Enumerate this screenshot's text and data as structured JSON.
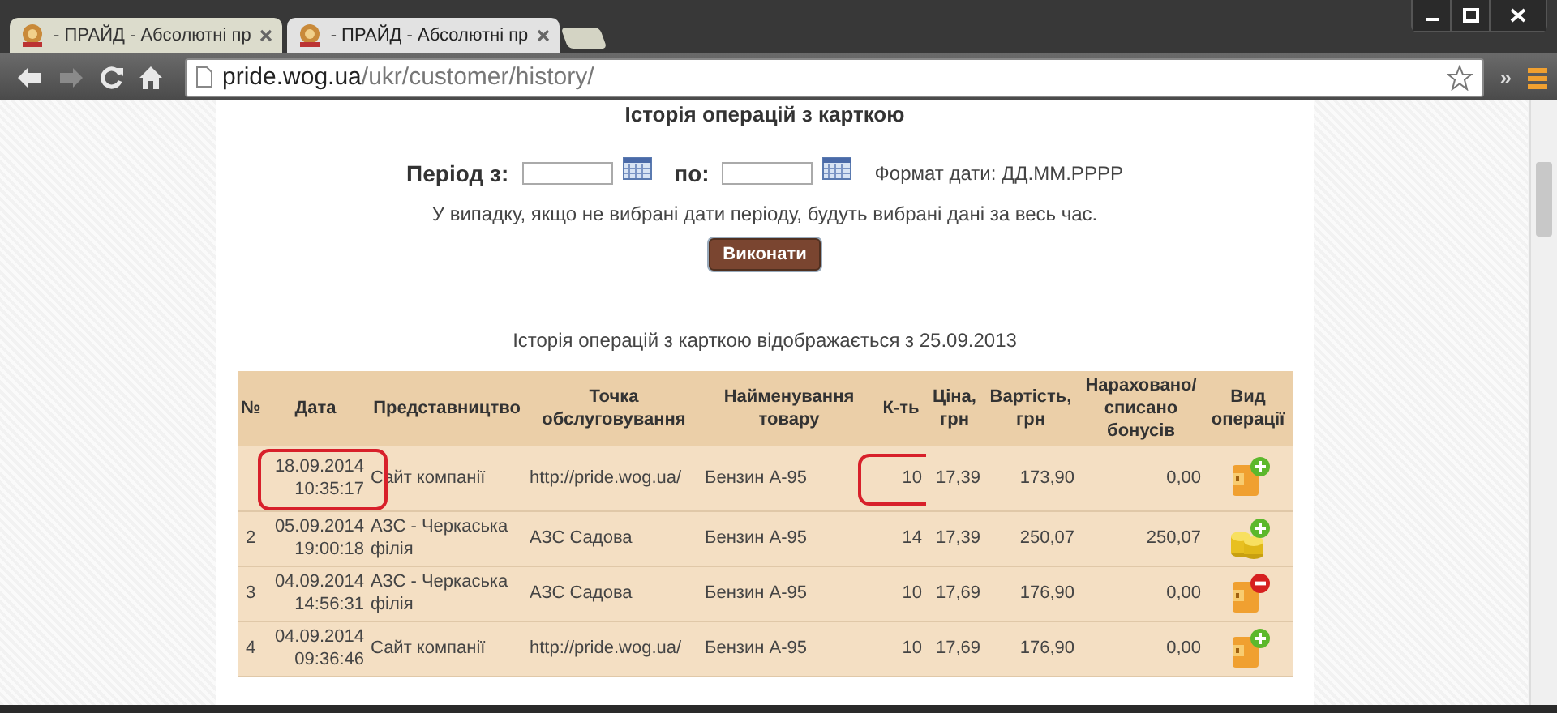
{
  "window": {
    "tabs": [
      {
        "title": "- ПРАЙД - Абсолютні пр",
        "selected": false
      },
      {
        "title": "- ПРАЙД - Абсолютні пр",
        "selected": true
      }
    ],
    "address": {
      "host": "pride.wog.ua",
      "path": "/ukr/customer/history/"
    },
    "chevron": "»"
  },
  "page": {
    "title": "Історія операцій з карткою",
    "period_from_label": "Період з:",
    "period_to_label": "по:",
    "date_format": "Формат дати: ДД.ММ.РРРР",
    "note": "У випадку, якщо не вибрані дати періоду, будуть вибрані дані за весь час.",
    "submit_button": "Виконати",
    "history_note": "Історія операцій з карткою відображається з 25.09.2013",
    "table": {
      "columns": [
        "№",
        "Дата",
        "Представництво",
        "Точка обслуговування",
        "Найменування товару",
        "К-ть",
        "Ціна, грн",
        "Вартість, грн",
        "Нараховано/ списано бонусів",
        "Вид операції"
      ],
      "rows": [
        {
          "date": "18.09.2014",
          "time": "10:35:17",
          "office": "Сайт компанії",
          "point": "http://pride.wog.ua/",
          "product": "Бензин А-95",
          "qty": "10",
          "price": "17,39",
          "cost": "173,90",
          "bonuses": "0,00",
          "kind": "credit",
          "annotated": true
        },
        {
          "no": "2",
          "date": "05.09.2014",
          "time": "19:00:18",
          "office": "АЗС - Черкаська філія",
          "point": "АЗС Садова",
          "product": "Бензин А-95",
          "qty": "14",
          "price": "17,39",
          "cost": "250,07",
          "bonuses": "250,07",
          "kind": "bonus",
          "annotated": false
        },
        {
          "no": "3",
          "date": "04.09.2014",
          "time": "14:56:31",
          "office": "АЗС - Черкаська філія",
          "point": "АЗС Садова",
          "product": "Бензин А-95",
          "qty": "10",
          "price": "17,69",
          "cost": "176,90",
          "bonuses": "0,00",
          "kind": "debit",
          "annotated": false
        },
        {
          "no": "4",
          "date": "04.09.2014",
          "time": "09:36:46",
          "office": "Сайт компанії",
          "point": "http://pride.wog.ua/",
          "product": "Бензин А-95",
          "qty": "10",
          "price": "17,69",
          "cost": "176,90",
          "bonuses": "0,00",
          "kind": "credit",
          "annotated": false
        }
      ]
    }
  }
}
